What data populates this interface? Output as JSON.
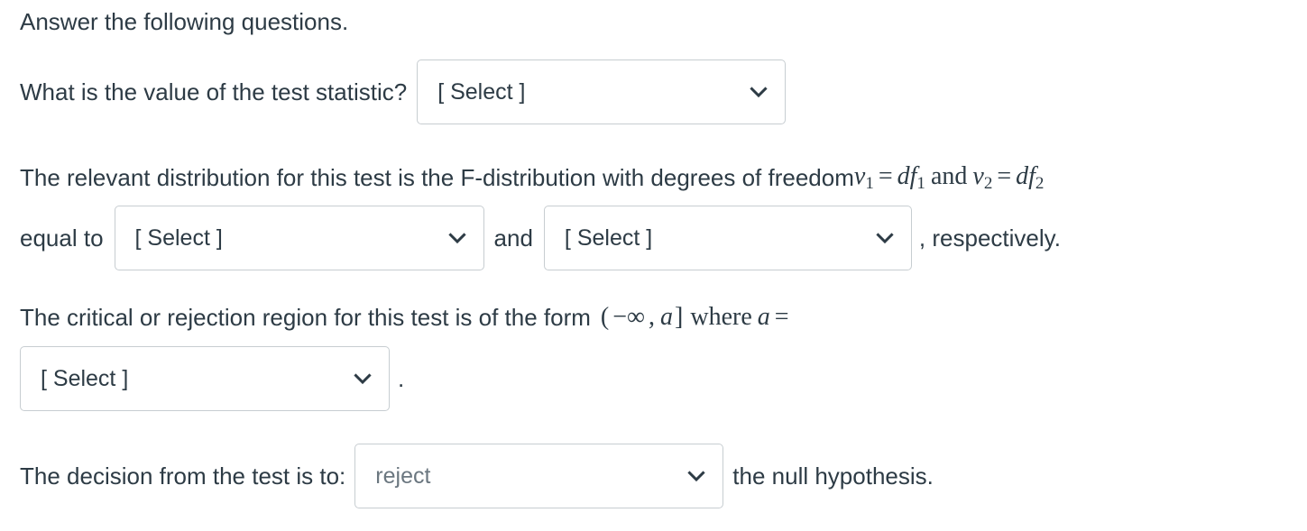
{
  "page": {
    "intro": "Answer the following questions.",
    "background_color": "#ffffff",
    "text_color": "#2d3b45",
    "control_border_color": "#c7cdd1",
    "chosen_value_color": "#6b7780"
  },
  "questions": [
    {
      "id": "test-statistic",
      "label": "What is the value of the test statistic?",
      "select": {
        "value": "[ Select ]",
        "is_placeholder": true,
        "icon": "chevron-down-icon"
      }
    },
    {
      "id": "degrees-of-freedom",
      "lead_text": "The relevant distribution for this test is the F-distribution with degrees of freedom",
      "math_lead": "ν₁ = df₁ and ν₂ = df₂",
      "math_parts": {
        "nu": "ν",
        "sub1": "1",
        "sub2": "2",
        "equals": "=",
        "df": "df",
        "and": "and"
      },
      "equal_to_text": "equal to",
      "between_text": "and",
      "trailing_text": ", respectively.",
      "select_1": {
        "value": "[ Select ]",
        "is_placeholder": true,
        "icon": "chevron-down-icon"
      },
      "select_2": {
        "value": "[ Select ]",
        "is_placeholder": true,
        "icon": "chevron-down-icon"
      }
    },
    {
      "id": "critical-region",
      "lead_text": "The critical or rejection region for this test is of the form",
      "math_interval": "(−∞, a]",
      "math_parts": {
        "open_paren": "(",
        "minus_infinity": "−∞",
        "comma": ",",
        "a": "a",
        "close_bracket": "]",
        "where": "where",
        "equals": "="
      },
      "select": {
        "value": "[ Select ]",
        "is_placeholder": true,
        "icon": "chevron-down-icon"
      },
      "trailing_text": "."
    },
    {
      "id": "decision",
      "label": "The decision from the test is to:",
      "select": {
        "value": "reject",
        "is_placeholder": false,
        "icon": "chevron-down-icon"
      },
      "trailing_text": "the null hypothesis."
    }
  ]
}
